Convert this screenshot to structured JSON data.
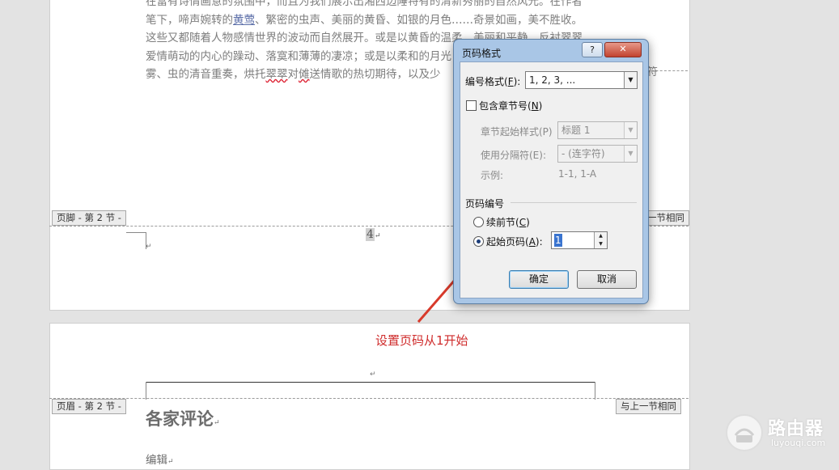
{
  "document": {
    "paragraph_lines": [
      [
        "在富有诗情画意的氛围中，而且为我们展示出湘西边陲特有的清新秀丽的自然风光。在作者"
      ],
      [
        "笔下，啼声婉转的",
        {
          "link": "黄莺"
        },
        "、繁密的虫声、美丽的黄昏、如银的月色……奇景如画，美不胜收。"
      ],
      [
        "这些又都随着人物感情世界的波动而自然展开。或是以黄昏的温柔、美丽和平静，反衬翠翠"
      ],
      [
        "爱情萌动的内心的躁动、落寞和薄薄的凄凉；或是以柔和的月光"
      ],
      [
        "雾、虫的清音重奏，烘托",
        {
          "squig": "翠翠"
        },
        "对",
        {
          "squig": "傩"
        },
        "送情歌的热切期待，以及少"
      ]
    ],
    "footer_tag": "页脚 - 第 2 节 -",
    "right_tag_partial": "与上一节相同",
    "page_number": "4",
    "return_mark": "↵",
    "header_tag": "页眉 - 第 2 节 -",
    "header_same_as_prev": "与上一节相同",
    "heading": "各家评论",
    "para": "编辑"
  },
  "annotation": {
    "text": "设置页码从1开始",
    "color": "#cf2b2b"
  },
  "dialog": {
    "title": "页码格式",
    "help": "?",
    "close": "✕",
    "format_label": "编号格式(",
    "format_key": "F",
    "format_value": "1, 2, 3, ...",
    "include_chapter_label": "包含章节号(",
    "include_chapter_key": "N",
    "include_chapter_checked": false,
    "chapter_style_label": "章节起始样式(P)",
    "chapter_style_value": "标题 1",
    "separator_label": "使用分隔符(E):",
    "separator_value": "-  (连字符)",
    "example_label": "示例:",
    "example_value": "1-1, 1-A",
    "numbering_group": "页码编号",
    "continue_label": "续前节(",
    "continue_key": "C",
    "start_label": "起始页码(",
    "start_key": "A",
    "selected": "start_at",
    "start_value": "1",
    "ok": "确定",
    "cancel": "取消"
  },
  "watermark": {
    "title": "路由器",
    "subtitle": "luyouqi.com"
  },
  "colors": {
    "dialog_frame": "#a9c6e6",
    "close_button": "#c2432f",
    "link": "#5b6ea8"
  }
}
